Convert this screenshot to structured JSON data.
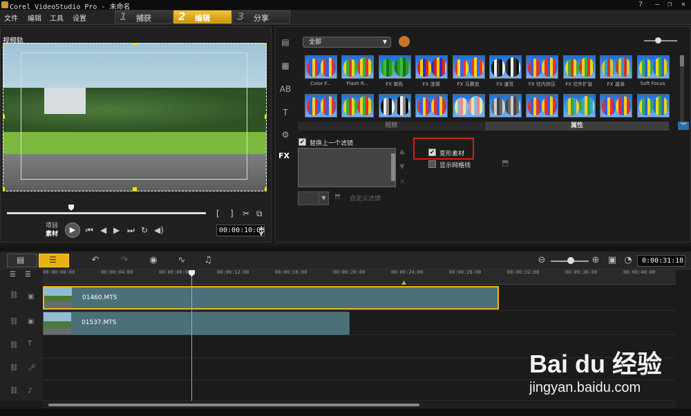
{
  "window": {
    "title": "Corel VideoStudio Pro - 未命名",
    "buttons": [
      "?",
      "—",
      "❐",
      "✕"
    ]
  },
  "menu": {
    "items": [
      "文件",
      "编辑",
      "工具",
      "设置"
    ]
  },
  "steps": [
    {
      "num": "1",
      "label": "捕获"
    },
    {
      "num": "2",
      "label": "编辑"
    },
    {
      "num": "3",
      "label": "分享"
    }
  ],
  "preview": {
    "track_label": "视频轨",
    "mode_project": "项目",
    "mode_clip": "素材",
    "timecode": "00:00:10:08"
  },
  "library": {
    "category": "全部",
    "filters_row1": [
      "Color F...",
      "Flash R...",
      "FX 单色",
      "FX 涟漪",
      "FX 马赛克",
      "FX 速写",
      "FX 往内挤压",
      "FX 往外扩张",
      "FX 漩涡",
      "Soft Focus"
    ],
    "filters_row2": [
      "",
      "",
      "",
      "",
      "",
      "",
      "",
      "",
      "",
      ""
    ],
    "tab_video": "视频",
    "tab_properties": "属性",
    "replace_last_filter": "替换上一个滤镜",
    "deform_clip": "变形素材",
    "show_grid": "显示网格线",
    "custom_filter": "自定义滤镜",
    "side_icons": [
      "media-icon",
      "transition-icon",
      "title-icon",
      "text-icon",
      "graphic-icon"
    ],
    "fx_label": "FX"
  },
  "timeline": {
    "duration": "0:00:31:18",
    "ruler_ticks": [
      "00:00:00:00",
      "00:00:04:00",
      "00:00:08:00",
      "00:00:12:00",
      "00:00:16:00",
      "00:00:20:00",
      "00:00:24:00",
      "00:00:28:00",
      "00:00:32:00",
      "00:00:36:00",
      "00:00:40:00"
    ],
    "clips": [
      {
        "name": "01460.MTS"
      },
      {
        "name": "01537.MTS"
      }
    ]
  },
  "watermark": {
    "logo": "Bai du 经验",
    "url": "jingyan.baidu.com"
  },
  "colors": {
    "accent": "#f2b61a",
    "highlight": "#e01a1a"
  }
}
